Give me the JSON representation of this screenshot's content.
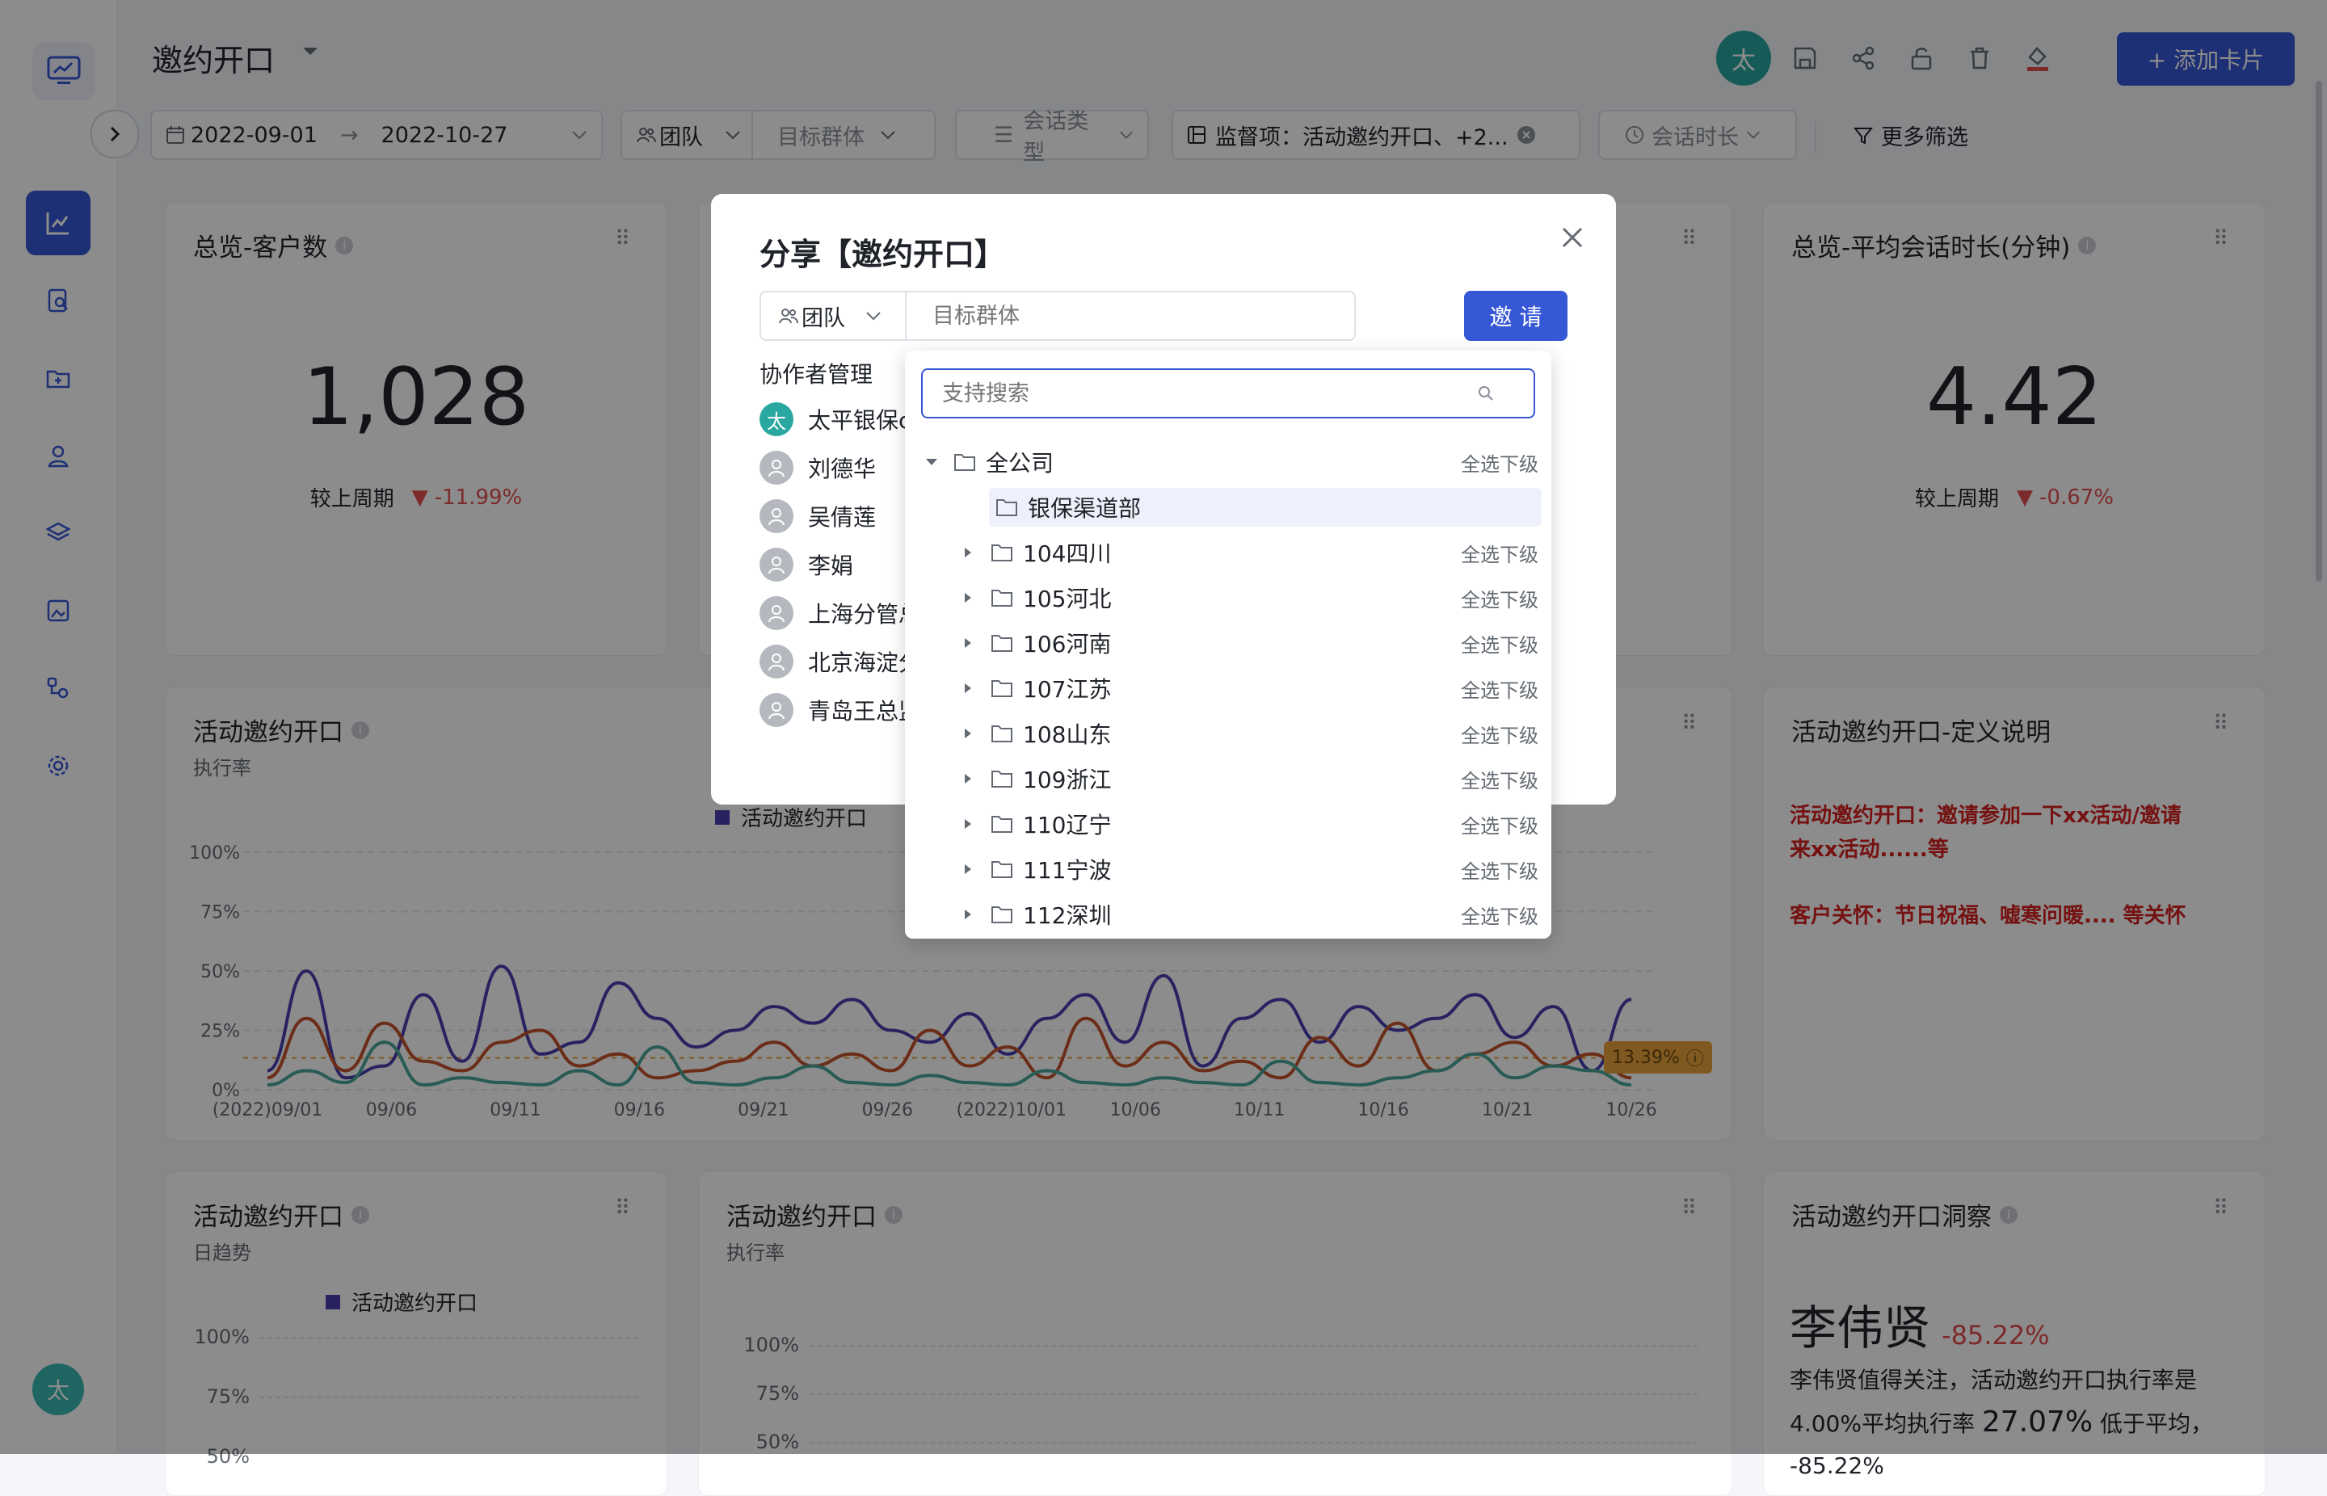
{
  "app": {
    "title": "邀约开口",
    "add_card": "+ 添加卡片",
    "user_initial": "太"
  },
  "filters": {
    "date_start": "2022-09-01",
    "date_end": "2022-10-27",
    "team": "团队",
    "target_group": "目标群体",
    "session_type": "会话类型",
    "monitor": "监督项：活动邀约开口、+2...",
    "duration": "会话时长",
    "more": "更多筛选"
  },
  "cards": {
    "customers": {
      "title": "总览-客户数",
      "value": "1,028",
      "compare_label": "较上周期",
      "change": "-11.99%"
    },
    "avg_duration": {
      "title": "总览-平均会话时长(分钟)",
      "value": "4.42",
      "compare_label": "较上周期",
      "change": "-0.67%"
    },
    "trend": {
      "title": "活动邀约开口",
      "subtitle": "执行率",
      "legend": "活动邀约开口",
      "avg_badge": "13.39%"
    },
    "definition": {
      "title": "活动邀约开口-定义说明",
      "line1": "活动邀约开口：邀请参加一下xx活动/邀请",
      "line2": "来xx活动......等",
      "line3": "客户关怀：节日祝福、嘘寒问暖.... 等关怀"
    },
    "daily": {
      "title": "活动邀约开口",
      "subtitle": "日趋势",
      "legend": "活动邀约开口"
    },
    "rate2": {
      "title": "活动邀约开口",
      "subtitle": "执行率"
    },
    "insight": {
      "title": "活动邀约开口洞察",
      "name": "李伟贤",
      "change": "-85.22%",
      "text1": "李伟贤值得关注，活动邀约开口执行率是",
      "text2_a": "4.00%平均执行率",
      "text2_b": "27.07%",
      "text2_c": "低于平均，",
      "text3": "-85.22%"
    }
  },
  "chart_data": {
    "type": "line",
    "x_ticks": [
      "(2022)09/01",
      "09/06",
      "09/11",
      "09/16",
      "09/21",
      "09/26",
      "(2022)10/01",
      "10/06",
      "10/11",
      "10/16",
      "10/21",
      "10/26"
    ],
    "y_ticks": [
      "100%",
      "75%",
      "50%",
      "25%",
      "0%"
    ],
    "ylim": [
      0,
      100
    ],
    "average": 13.39,
    "series": [
      {
        "name": "活动邀约开口",
        "color": "#4a3fb0",
        "values": [
          8,
          50,
          5,
          10,
          40,
          12,
          52,
          15,
          20,
          45,
          30,
          18,
          25,
          35,
          28,
          38,
          25,
          20,
          32,
          15,
          30,
          40,
          20,
          48,
          10,
          30,
          38,
          20,
          35,
          25,
          30,
          40,
          22,
          35,
          8,
          38
        ]
      },
      {
        "color": "#c4522a",
        "values": [
          5,
          30,
          8,
          28,
          12,
          8,
          20,
          25,
          10,
          15,
          5,
          8,
          12,
          20,
          10,
          15,
          8,
          25,
          10,
          18,
          5,
          30,
          10,
          20,
          8,
          12,
          5,
          22,
          10,
          28,
          8,
          15,
          20,
          10,
          15,
          5
        ]
      },
      {
        "color": "#4aa79a",
        "values": [
          2,
          8,
          3,
          20,
          2,
          5,
          3,
          2,
          8,
          2,
          18,
          3,
          2,
          5,
          10,
          3,
          2,
          6,
          3,
          2,
          8,
          3,
          2,
          5,
          3,
          2,
          12,
          3,
          2,
          5,
          8,
          15,
          5,
          10,
          8,
          2
        ]
      }
    ],
    "y_ticks_small": [
      "100%",
      "75%",
      "50%"
    ]
  },
  "modal": {
    "title": "分享【邀约开口】",
    "team_select": "团队",
    "target_placeholder": "目标群体",
    "invite": "邀 请",
    "collab_header": "协作者管理",
    "collaborators": [
      "太平银保c",
      "刘德华",
      "吴倩莲",
      "李娟",
      "上海分管总",
      "北京海淀分",
      "青岛王总监"
    ]
  },
  "dropdown": {
    "search_placeholder": "支持搜索",
    "root": "全公司",
    "select_all": "全选下级",
    "items": [
      "银保渠道部",
      "104四川",
      "105河北",
      "106河南",
      "107江苏",
      "108山东",
      "109浙江",
      "110辽宁",
      "111宁波",
      "112深圳"
    ]
  }
}
